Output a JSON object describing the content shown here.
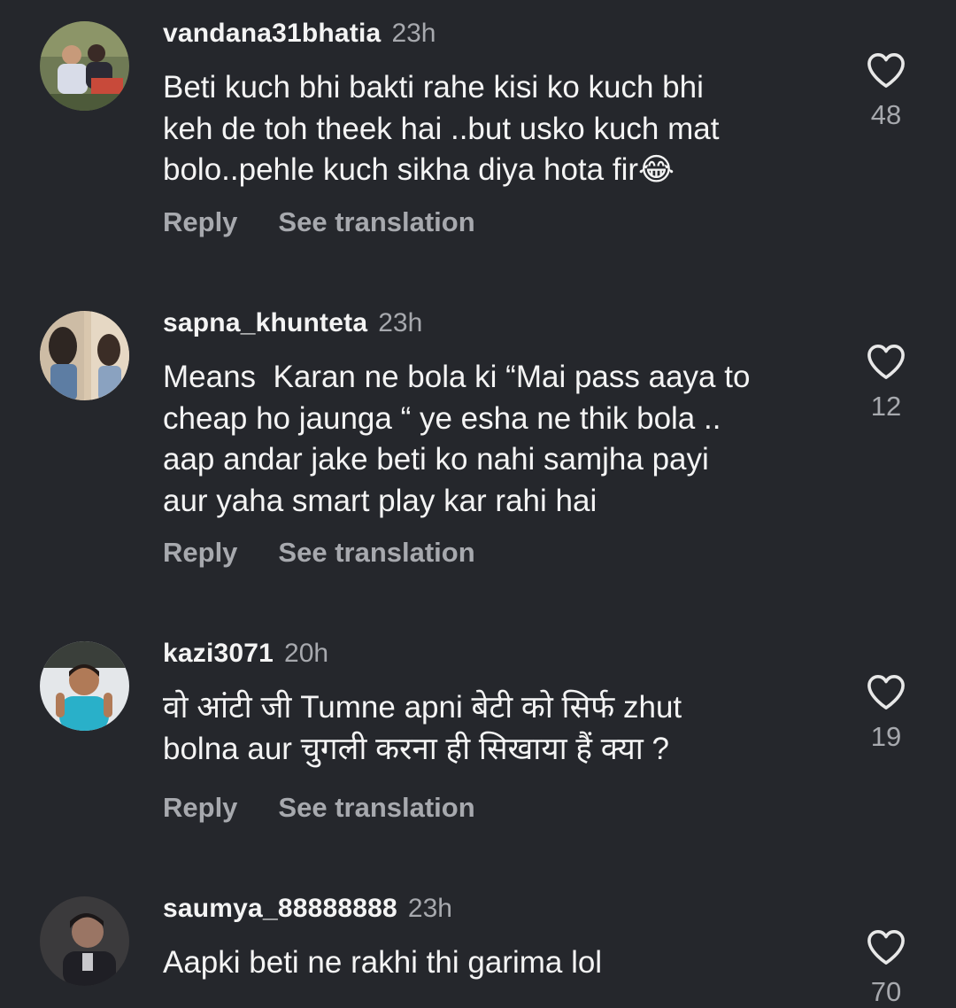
{
  "comments": [
    {
      "username": "vandana31bhatia",
      "time": "23h",
      "text": "Beti kuch bhi bakti rahe kisi ko kuch bhi\nkeh de toh theek hai ..but usko kuch mat\nbolo..pehle kuch sikha diya hota fir😂",
      "likes": "48",
      "reply_label": "Reply",
      "translate_label": "See translation"
    },
    {
      "username": "sapna_khunteta",
      "time": "23h",
      "text": "Means  Karan ne bola ki “Mai pass aaya to\ncheap ho jaunga “ ye esha ne thik bola ..\naap andar jake beti ko nahi samjha payi\naur yaha smart play kar rahi hai",
      "likes": "12",
      "reply_label": "Reply",
      "translate_label": "See translation"
    },
    {
      "username": "kazi3071",
      "time": "20h",
      "text": "वो आंटी जी Tumne apni बेटी को सिर्फ zhut\nbolna aur चुगली करना ही सिखाया हैं क्या ?",
      "likes": "19",
      "reply_label": "Reply",
      "translate_label": "See translation"
    },
    {
      "username": "saumya_88888888",
      "time": "23h",
      "text": "Aapki beti ne rakhi thi garima lol",
      "likes": "70"
    }
  ]
}
